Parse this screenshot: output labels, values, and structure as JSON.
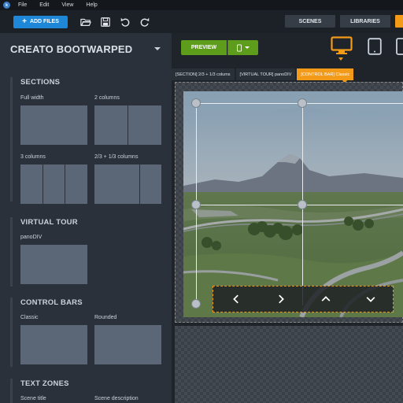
{
  "menu": {
    "items": [
      "File",
      "Edit",
      "View",
      "Help"
    ]
  },
  "toolbar": {
    "add_files_label": "ADD FILES",
    "scenes_label": "SCENES",
    "libraries_label": "LIBRARIES"
  },
  "project": {
    "title": "CREATO BOOTWARPED"
  },
  "sections": {
    "heading": "SECTIONS",
    "items": [
      {
        "label": "Full width"
      },
      {
        "label": "2 columns"
      },
      {
        "label": "3 columns"
      },
      {
        "label": "2/3 + 1/3 columns"
      }
    ]
  },
  "virtual_tour": {
    "heading": "VIRTUAL TOUR",
    "items": [
      {
        "label": "panoDIV"
      }
    ]
  },
  "control_bars": {
    "heading": "CONTROL BARS",
    "items": [
      {
        "label": "Classic"
      },
      {
        "label": "Rounded"
      }
    ]
  },
  "text_zones": {
    "heading": "TEXT ZONES",
    "items": [
      {
        "label": "Scene title"
      },
      {
        "label": "Scene description"
      }
    ]
  },
  "editor": {
    "preview_label": "PREVIEW",
    "breadcrumbs": [
      {
        "label": "[SECTION] 2/3 + 1/3 colums"
      },
      {
        "label": "[VIRTUAL TOUR] panoDIV"
      },
      {
        "label": "[CONTROL BAR] Classic"
      }
    ]
  },
  "colors": {
    "accent": "#f39a18",
    "primary_blue": "#1e87d8",
    "preview_green": "#5e9c1c",
    "panel_bg": "#2b313a"
  },
  "icons": {
    "toolbar": [
      "open-folder-icon",
      "save-icon",
      "undo-icon",
      "redo-icon"
    ],
    "devices": [
      "desktop-icon",
      "tablet-icon",
      "phone-icon"
    ],
    "control_bar": [
      "chevron-left-icon",
      "chevron-right-icon",
      "chevron-up-icon",
      "chevron-down-icon"
    ]
  }
}
